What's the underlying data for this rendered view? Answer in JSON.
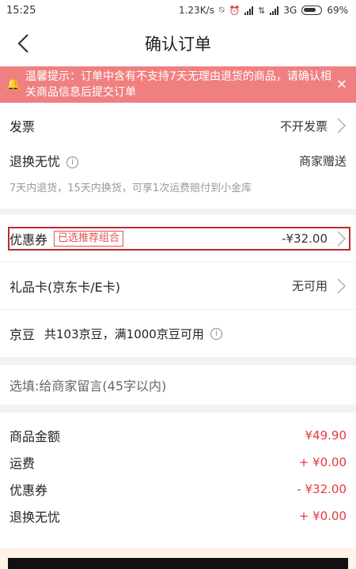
{
  "status": {
    "time": "15:25",
    "speed": "1.23K/s",
    "network": "3G",
    "battery": "69%"
  },
  "nav": {
    "title": "确认订单"
  },
  "notice": {
    "text": "温馨提示：订单中含有不支持7天无理由退货的商品，请确认相关商品信息后提交订单"
  },
  "invoice": {
    "label": "发票",
    "value": "不开发票"
  },
  "returns": {
    "label": "退换无忧",
    "value": "商家赠送",
    "desc": "7天内退货，15天内换货，可享1次运费赔付到小金库"
  },
  "coupon": {
    "label": "优惠券",
    "tag": "已选推荐组合",
    "value": "-¥32.00"
  },
  "giftcard": {
    "label": "礼品卡(京东卡/E卡)",
    "value": "无可用"
  },
  "jingdou": {
    "label": "京豆",
    "desc": "共103京豆，满1000京豆可用"
  },
  "message": {
    "placeholder": "选填:给商家留言(45字以内)"
  },
  "summary": [
    {
      "label": "商品金额",
      "value": "¥49.90"
    },
    {
      "label": "运费",
      "value": "+ ¥0.00"
    },
    {
      "label": "优惠券",
      "value": "- ¥32.00"
    },
    {
      "label": "退换无忧",
      "value": "+ ¥0.00"
    }
  ],
  "colors": {
    "accent_red": "#e4393c",
    "notice_bg": "#f08080",
    "highlight_border": "#c0282d"
  }
}
